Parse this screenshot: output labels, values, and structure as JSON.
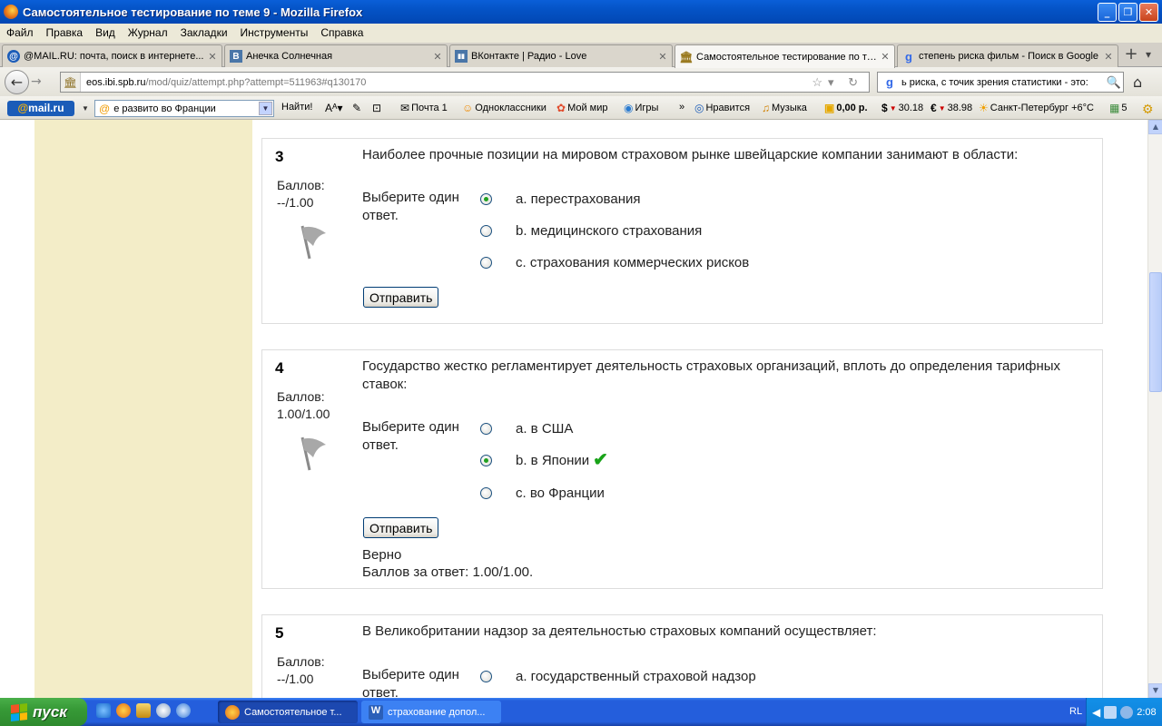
{
  "window": {
    "title": "Самостоятельное тестирование по теме 9 - Mozilla Firefox",
    "btn_min": "_",
    "btn_max": "❐",
    "btn_close": "✕"
  },
  "menu": [
    "Файл",
    "Правка",
    "Вид",
    "Журнал",
    "Закладки",
    "Инструменты",
    "Справка"
  ],
  "tabs": [
    {
      "label": "@MAIL.RU: почта, поиск в интернете...",
      "icon": "@",
      "icon_color": "#1B5CB8"
    },
    {
      "label": "Анечка Солнечная",
      "icon": "В",
      "icon_color": "#4A76A8"
    },
    {
      "label": "ВКонтакте | Радио - Love",
      "icon": "▮▮",
      "icon_color": "#4A76A8"
    },
    {
      "label": "Самостоятельное тестирование по те...",
      "icon": "🏛",
      "icon_color": "#C9A03C"
    },
    {
      "label": "степень риска фильм - Поиск в Google",
      "icon": "g",
      "icon_color": "#3369E8"
    }
  ],
  "tab_close": "✕",
  "new_tab": "+",
  "tabs_overflow": "▾",
  "nav": {
    "back": "←",
    "forward": "→",
    "url_host": "eos.",
    "url_domain": "ibi.spb.ru",
    "url_path": "/mod/quiz/attempt.php?attempt=511963#q130170",
    "url_icons": "☆▾ ↻",
    "search_text": "ь риска, с точик зрения статистики - это:",
    "search_btn": "🔍",
    "home": "⌂"
  },
  "mailbar": {
    "logo_at": "@",
    "logo_text": "mail.ru",
    "search_value": "е развито во Франции",
    "find": "Найти!",
    "items": [
      {
        "icon": "✉",
        "label": "Почта 1"
      },
      {
        "icon": "☺",
        "label": "Одноклассники"
      },
      {
        "icon": "✿",
        "label": "Мой мир"
      },
      {
        "icon": "◉",
        "label": "Игры"
      },
      {
        "icon": "»",
        "label": ""
      },
      {
        "icon": "◎",
        "label": "Нравится"
      },
      {
        "icon": "♫",
        "label": "Музыка"
      },
      {
        "icon": "▣",
        "label": "0,00 р."
      },
      {
        "icon": "$",
        "label": "30.18"
      },
      {
        "icon": "€",
        "label": "38.98"
      },
      {
        "icon": "☀",
        "label": "Санкт-Петербург +6°C"
      },
      {
        "icon": "▦",
        "label": "5"
      },
      {
        "icon": "⚙",
        "label": ""
      }
    ]
  },
  "questions": [
    {
      "number": "3",
      "grade_label": "Баллов:",
      "grade_value": "--/1.00",
      "text": "Наиболее прочные позиции на мировом страховом рынке швейцарские компании занимают в области:",
      "prompt": "Выберите один ответ.",
      "options": [
        {
          "label": "a. перестрахования",
          "checked": true
        },
        {
          "label": "b. медицинского страхования",
          "checked": false
        },
        {
          "label": "c. страхования коммерческих рисков",
          "checked": false
        }
      ],
      "submit": "Отправить"
    },
    {
      "number": "4",
      "grade_label": "Баллов:",
      "grade_value": "1.00/1.00",
      "text": "Государство жестко регламентирует деятельность страховых организаций, вплоть до определения тарифных ставок:",
      "prompt": "Выберите один ответ.",
      "options": [
        {
          "label": "a. в США",
          "checked": false
        },
        {
          "label": "b. в Японии",
          "checked": true,
          "correct_mark": "✔"
        },
        {
          "label": "c. во Франции",
          "checked": false
        }
      ],
      "submit": "Отправить",
      "feedback_status": "Верно",
      "feedback_score": "Баллов за ответ: 1.00/1.00."
    },
    {
      "number": "5",
      "grade_label": "Баллов:",
      "grade_value": "--/1.00",
      "text": "В Великобритании надзор за деятельностью страховых компаний осуществляет:",
      "prompt": "Выберите один ответ.",
      "options": [
        {
          "label": "a. государственный страховой надзор",
          "checked": false
        }
      ]
    }
  ],
  "scrollbar": {
    "up": "▲",
    "down": "▼"
  },
  "taskbar": {
    "start": "пуск",
    "items": [
      {
        "label": "Самостоятельное т...",
        "active": true
      },
      {
        "label": "страхование допол...",
        "active": false
      }
    ],
    "lang": "RL",
    "clock": "2:08"
  },
  "colors": {
    "sidebar": "#F3EDC8",
    "xp_blue": "#245EDC",
    "correct": "#19A319"
  }
}
